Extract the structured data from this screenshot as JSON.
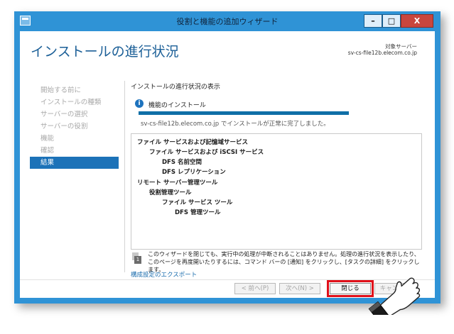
{
  "window": {
    "title": "役割と機能の追加ウィザード",
    "minimize_glyph": "–",
    "maximize_glyph": "□",
    "close_glyph": "X"
  },
  "header": {
    "title": "インストールの進行状況",
    "server_label": "対象サーバー",
    "server_name": "sv-cs-file12b.elecom.co.jp"
  },
  "nav": {
    "items": [
      {
        "label": "開始する前に",
        "active": false
      },
      {
        "label": "インストールの種類",
        "active": false
      },
      {
        "label": "サーバーの選択",
        "active": false
      },
      {
        "label": "サーバーの役割",
        "active": false
      },
      {
        "label": "機能",
        "active": false
      },
      {
        "label": "確認",
        "active": false
      },
      {
        "label": "結果",
        "active": true
      }
    ]
  },
  "main": {
    "section_heading": "インストールの進行状況の表示",
    "info_icon_glyph": "i",
    "info_label": "機能のインストール",
    "progress": 1.0,
    "complete_message": "sv-cs-file12b.elecom.co.jp でインストールが正常に完了しました。",
    "results": [
      {
        "text": "ファイル サービスおよび記憶域サービス",
        "level": 0
      },
      {
        "text": "ファイル サービスおよび iSCSI サービス",
        "level": 1
      },
      {
        "text": "DFS 名前空間",
        "level": 2
      },
      {
        "text": "DFS レプリケーション",
        "level": 2
      },
      {
        "text": "リモート サーバー管理ツール",
        "level": 0
      },
      {
        "text": "役割管理ツール",
        "level": 1
      },
      {
        "text": "ファイル サービス ツール",
        "level": 2
      },
      {
        "text": "DFS 管理ツール",
        "level": 3
      }
    ],
    "note_icon_glyph": "1",
    "note_text": "このウィザードを閉じても、実行中の処理が中断されることはありません。処理の進行状況を表示したり、このページを再度開いたりするには、コマンド バーの [通知] をクリックし、[タスクの詳細] をクリックします。",
    "config_link": "構成設定のエクスポート"
  },
  "footer": {
    "prev_label": "< 前へ(P)",
    "next_label": "次へ(N) >",
    "close_label": "閉じる",
    "cancel_label": "キャンセル"
  },
  "colors": {
    "titlebar": "#2f93d6",
    "accent": "#1c72b8",
    "highlight": "#e0101a",
    "title_text": "#1b5f97"
  }
}
